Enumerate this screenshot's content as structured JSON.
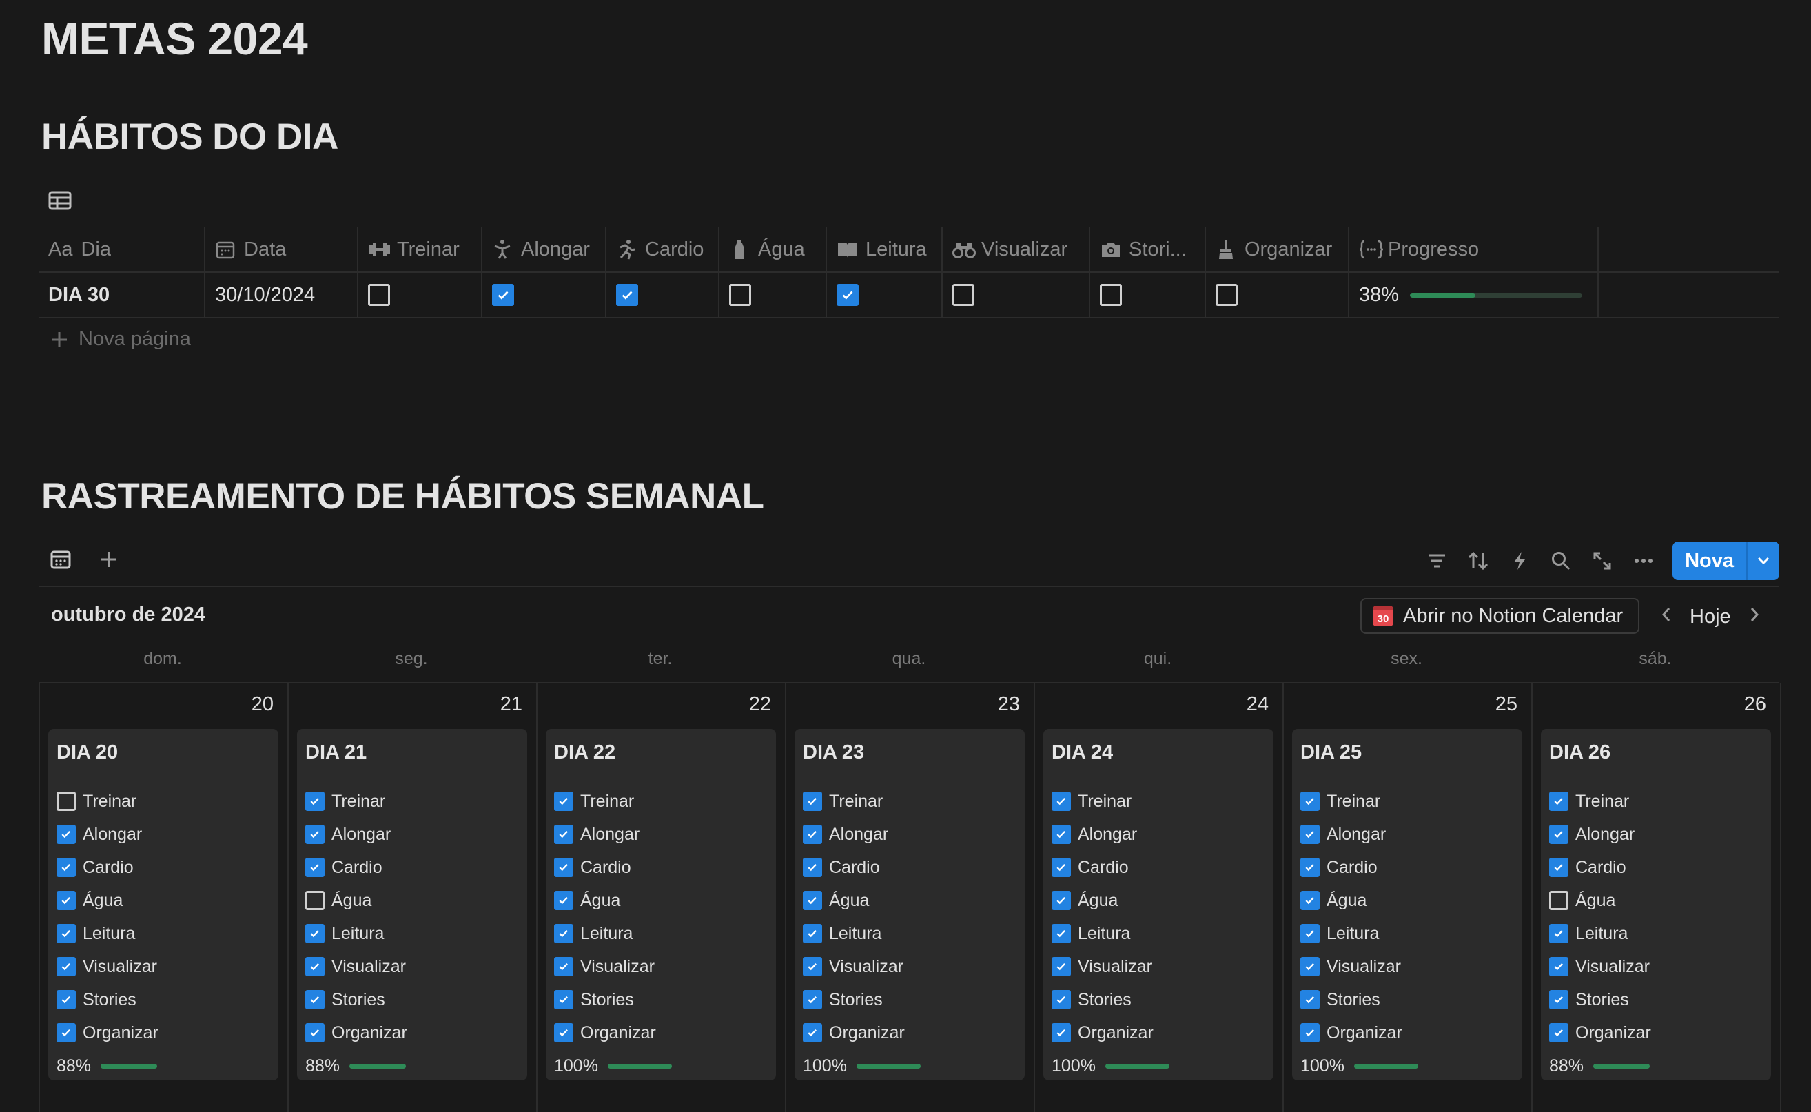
{
  "page_title": "METAS 2024",
  "section1_title": "HÁBITOS DO DIA",
  "section2_title": "RASTREAMENTO DE HÁBITOS SEMANAL",
  "table": {
    "columns": [
      {
        "icon": "aa-text-icon",
        "label": "Dia",
        "prefix": "Aa"
      },
      {
        "icon": "calendar-icon",
        "label": "Data"
      },
      {
        "icon": "dumbbell-icon",
        "label": "Treinar"
      },
      {
        "icon": "stretch-person-icon",
        "label": "Alongar"
      },
      {
        "icon": "running-icon",
        "label": "Cardio"
      },
      {
        "icon": "water-bottle-icon",
        "label": "Água"
      },
      {
        "icon": "book-icon",
        "label": "Leitura"
      },
      {
        "icon": "binoculars-icon",
        "label": "Visualizar"
      },
      {
        "icon": "camera-icon",
        "label": "Stori..."
      },
      {
        "icon": "broom-icon",
        "label": "Organizar"
      },
      {
        "icon": "formula-icon",
        "label": "Progresso"
      }
    ],
    "row": {
      "dia": "DIA 30",
      "data": "30/10/2024",
      "checks": [
        false,
        true,
        true,
        false,
        true,
        false,
        false,
        false
      ],
      "progresso": "38%",
      "progresso_value": 0.38
    },
    "new_page": "Nova página"
  },
  "calendar": {
    "month": "outubro de 2024",
    "open_button": "Abrir no Notion Calendar",
    "open_icon_text": "30",
    "today": "Hoje",
    "new_button": "Nova",
    "weekdays": [
      "dom.",
      "seg.",
      "ter.",
      "qua.",
      "qui.",
      "sex.",
      "sáb."
    ],
    "habit_labels": [
      "Treinar",
      "Alongar",
      "Cardio",
      "Água",
      "Leitura",
      "Visualizar",
      "Stories",
      "Organizar"
    ],
    "days": [
      {
        "num": "20",
        "title": "DIA 20",
        "checks": [
          false,
          true,
          true,
          true,
          true,
          true,
          true,
          true
        ],
        "progress": "88%",
        "progress_value": 0.88
      },
      {
        "num": "21",
        "title": "DIA 21",
        "checks": [
          true,
          true,
          true,
          false,
          true,
          true,
          true,
          true
        ],
        "progress": "88%",
        "progress_value": 0.88
      },
      {
        "num": "22",
        "title": "DIA 22",
        "checks": [
          true,
          true,
          true,
          true,
          true,
          true,
          true,
          true
        ],
        "progress": "100%",
        "progress_value": 1.0
      },
      {
        "num": "23",
        "title": "DIA 23",
        "checks": [
          true,
          true,
          true,
          true,
          true,
          true,
          true,
          true
        ],
        "progress": "100%",
        "progress_value": 1.0
      },
      {
        "num": "24",
        "title": "DIA 24",
        "checks": [
          true,
          true,
          true,
          true,
          true,
          true,
          true,
          true
        ],
        "progress": "100%",
        "progress_value": 1.0
      },
      {
        "num": "25",
        "title": "DIA 25",
        "checks": [
          true,
          true,
          true,
          true,
          true,
          true,
          true,
          true
        ],
        "progress": "100%",
        "progress_value": 1.0
      },
      {
        "num": "26",
        "title": "DIA 26",
        "checks": [
          true,
          true,
          true,
          false,
          true,
          true,
          true,
          true
        ],
        "progress": "88%",
        "progress_value": 0.88
      }
    ]
  },
  "colors": {
    "accent": "#2383e2",
    "progress": "#2e8b57",
    "background": "#191919",
    "card": "#2b2b2b"
  }
}
